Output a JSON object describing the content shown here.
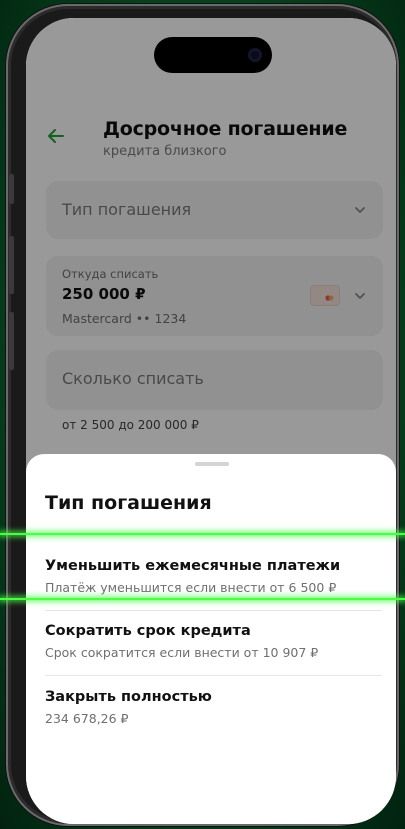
{
  "header": {
    "title": "Досрочное погашение",
    "subtitle": "кредита близкого"
  },
  "form": {
    "repayment_type_placeholder": "Тип погашения",
    "from_label": "Откуда списать",
    "from_amount": "250 000 ₽",
    "from_card": "Mastercard •• 1234",
    "amount_placeholder": "Сколько списать",
    "amount_hint": "от 2 500 до 200 000 ₽"
  },
  "sheet": {
    "title": "Тип погашения",
    "options": [
      {
        "title": "Уменьшить ежемесячные платежи",
        "subtitle": "Платёж уменьшится если внести от 6 500 ₽"
      },
      {
        "title": "Сократить срок кредита",
        "subtitle": "Срок сократится если внести от 10 907 ₽"
      },
      {
        "title": "Закрыть полностью",
        "subtitle": "234 678,26 ₽"
      }
    ]
  },
  "icons": {
    "back": "arrow-left-icon",
    "chevron": "chevron-down-icon",
    "card": "mastercard-icon"
  },
  "colors": {
    "accent": "#21a038",
    "highlight": "#48ff48",
    "background_gradient": "#0c7a34"
  }
}
